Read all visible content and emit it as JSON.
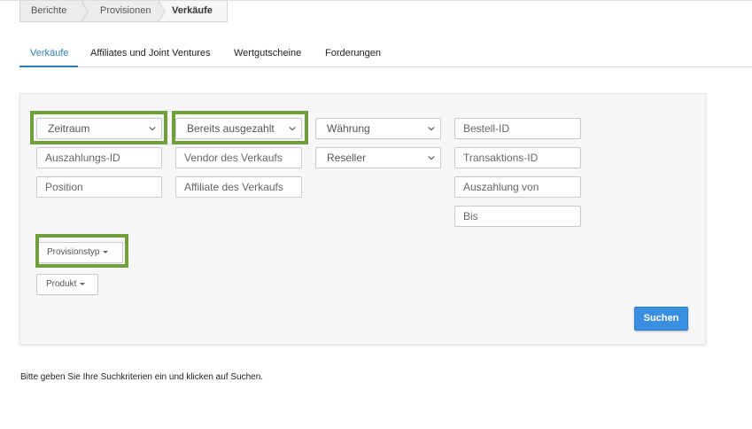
{
  "breadcrumb": {
    "items": [
      "Berichte",
      "Provisionen",
      "Verkäufe"
    ]
  },
  "tabs": [
    {
      "label": "Verkäufe",
      "active": true
    },
    {
      "label": "Affiliates und Joint Ventures",
      "active": false
    },
    {
      "label": "Wertgutscheine",
      "active": false
    },
    {
      "label": "Forderungen",
      "active": false
    }
  ],
  "filters": {
    "zeitraum": "Zeitraum",
    "bereits_ausgezahlt": "Bereits ausgezahlt",
    "waehrung": "Währung",
    "bestell_id": "Bestell-ID",
    "auszahlungs_id": "Auszahlungs-ID",
    "vendor": "Vendor des Verkaufs",
    "reseller": "Reseller",
    "transaktions_id": "Transaktions-ID",
    "position": "Position",
    "affiliate": "Affiliate des Verkaufs",
    "auszahlung_von": "Auszahlung von",
    "bis": "Bis",
    "provisionstyp": "Provisionstyp",
    "produkt": "Produkt"
  },
  "search_button": "Suchen",
  "hint": "Bitte geben Sie Ihre Suchkriterien ein und klicken auf Suchen.",
  "colors": {
    "accent": "#2a7fb5",
    "button": "#3a8fe0",
    "highlight": "#6f9f3b"
  }
}
